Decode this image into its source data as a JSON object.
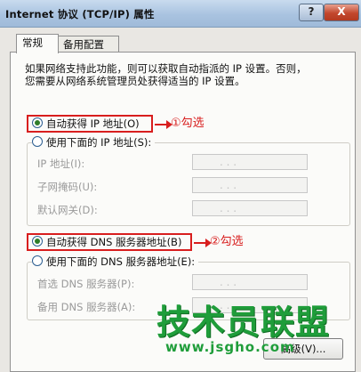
{
  "window": {
    "title": "Internet 协议 (TCP/IP) 属性",
    "help_label": "?",
    "close_label": "X"
  },
  "tabs": [
    {
      "label": "常规",
      "active": true
    },
    {
      "label": "备用配置",
      "active": false
    }
  ],
  "description": {
    "line1": "如果网络支持此功能，则可以获取自动指派的 IP 设置。否则，",
    "line2": "您需要从网络系统管理员处获得适当的 IP 设置。"
  },
  "ip": {
    "auto_label": "自动获得 IP 地址(O)",
    "auto_checked": true,
    "manual_label": "使用下面的 IP 地址(S):",
    "manual_checked": false,
    "fields": [
      {
        "label": "IP 地址(I):",
        "value": ". . ."
      },
      {
        "label": "子网掩码(U):",
        "value": ". . ."
      },
      {
        "label": "默认网关(D):",
        "value": ". . ."
      }
    ]
  },
  "dns": {
    "auto_label": "自动获得 DNS 服务器地址(B)",
    "auto_checked": true,
    "manual_label": "使用下面的 DNS 服务器地址(E):",
    "manual_checked": false,
    "fields": [
      {
        "label": "首选 DNS 服务器(P):",
        "value": ". . ."
      },
      {
        "label": "备用 DNS 服务器(A):",
        "value": ". . ."
      }
    ]
  },
  "annotations": {
    "step1": "①勾选",
    "step2": "②勾选",
    "color": "#d81e1e"
  },
  "buttons": {
    "advanced_label": "高级(V)..."
  },
  "watermark": {
    "text": "技术员联盟",
    "url": "www.jsgho.com"
  }
}
